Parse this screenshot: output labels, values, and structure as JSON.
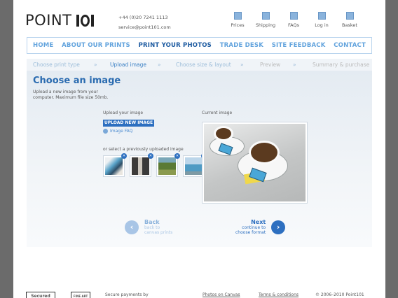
{
  "header": {
    "logo_text": "POINT",
    "logo_num": "101",
    "phone": "+44 (0)20 7241 1113",
    "email": "service@point101.com",
    "top_nav": [
      {
        "label": "Prices",
        "icon": "prices-icon"
      },
      {
        "label": "Shipping",
        "icon": "shipping-icon"
      },
      {
        "label": "FAQs",
        "icon": "faq-icon"
      },
      {
        "label": "Log in",
        "icon": "login-icon"
      },
      {
        "label": "Basket",
        "icon": "basket-icon"
      }
    ]
  },
  "main_nav": [
    "HOME",
    "ABOUT OUR PRINTS",
    "PRINT YOUR PHOTOS",
    "TRADE DESK",
    "SITE FEEDBACK",
    "CONTACT"
  ],
  "steps": [
    "Choose print type",
    "Upload image",
    "Choose size & layout",
    "Preview",
    "Summary & purchase"
  ],
  "content": {
    "title": "Choose an image",
    "intro": "Upload a new image from your computer. Maximum file size 50mb.",
    "upload_label": "Upload your image",
    "upload_button": "UPLOAD NEW IMAGE",
    "faq_link": "Image FAQ",
    "previous_label": "or select a previously uploaded image",
    "current_label": "Current image",
    "remove_glyph": "✕"
  },
  "navigation": {
    "back_title": "Back",
    "back_sub1": "back to",
    "back_sub2": "canvas prints",
    "next_title": "Next",
    "next_sub1": "continue to",
    "next_sub2": "choose format",
    "back_glyph": "‹",
    "next_glyph": "›"
  },
  "footer": {
    "secured": "Secured",
    "fineart": "FINE ART",
    "secure_payments": "Secure payments by",
    "photos_on_canvas": "Photos on Canvas",
    "terms": "Terms & conditions",
    "copyright": "© 2006–2010 Point101"
  },
  "colors": {
    "accent": "#2d6fc0",
    "nav_text": "#62a3dd",
    "active_nav": "#1c5aa0",
    "background": "#6b6b6b"
  }
}
